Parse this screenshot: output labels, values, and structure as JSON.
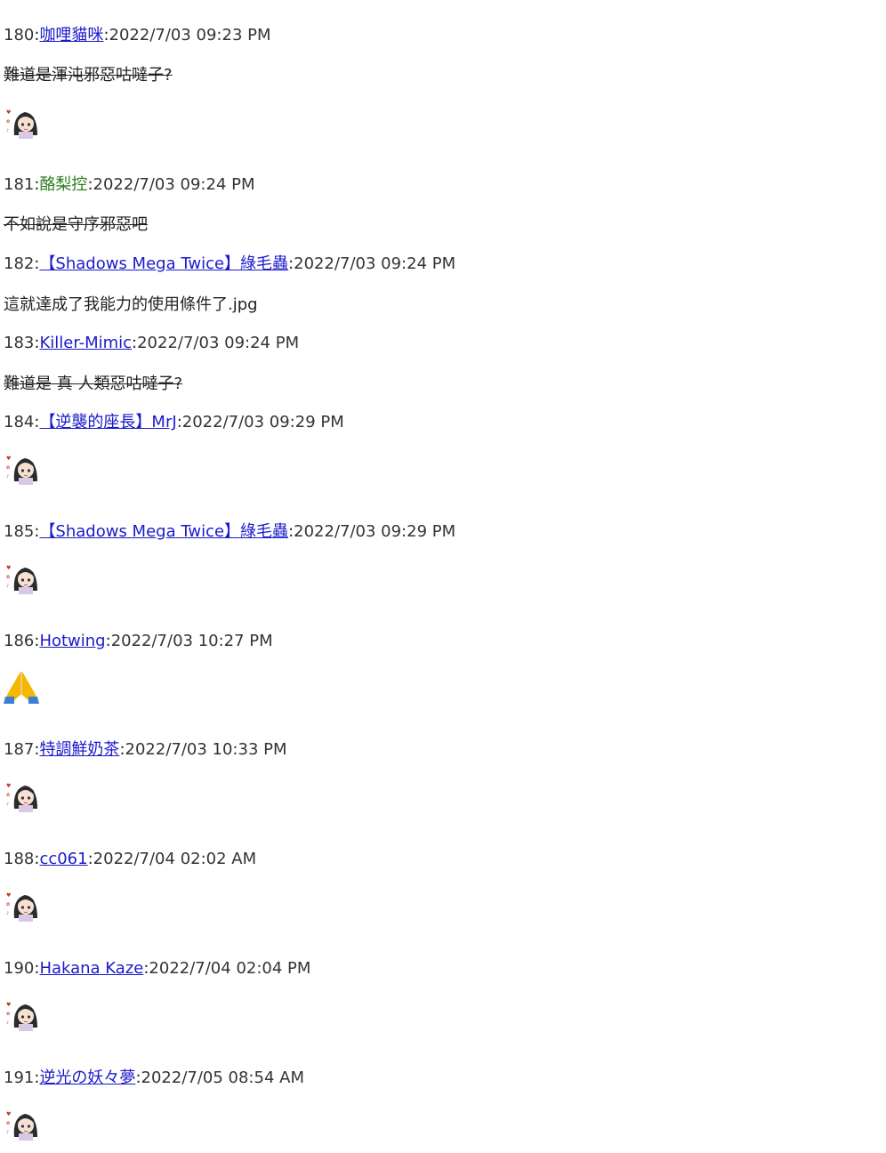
{
  "posts": [
    {
      "num": "180",
      "author": "咖哩貓咪",
      "date": "2022/7/03 09:23 PM",
      "text": "難道是渾沌邪惡咕噠子?",
      "strike": true,
      "sticker": true
    },
    {
      "num": "181",
      "author": "酪梨控",
      "date": "2022/7/03 09:24 PM",
      "text": "不如說是守序邪惡吧",
      "strike": true
    },
    {
      "num": "182",
      "author": "【Shadows Mega Twice】綠毛蟲",
      "date": "2022/7/03 09:24 PM",
      "text": "這就達成了我能力的使用條件了.jpg"
    },
    {
      "num": "183",
      "author": "Killer-Mimic",
      "date": "2022/7/03 09:24 PM",
      "text": "難道是 真 人類惡咕噠子?",
      "strike": true
    },
    {
      "num": "184",
      "author": "【逆襲的座長】MrJ",
      "date": "2022/7/03 09:29 PM",
      "sticker": true
    },
    {
      "num": "185",
      "author": "【Shadows Mega Twice】綠毛蟲",
      "date": "2022/7/03 09:29 PM",
      "sticker": true
    },
    {
      "num": "186",
      "author": "Hotwing",
      "date": "2022/7/03 10:27 PM",
      "emoji": "🙏"
    },
    {
      "num": "187",
      "author": "特調鮮奶茶",
      "date": "2022/7/03 10:33 PM",
      "sticker": true
    },
    {
      "num": "188",
      "author": "cc061",
      "date": "2022/7/04 02:02 AM",
      "sticker": true
    },
    {
      "num": "190",
      "author": "Hakana Kaze",
      "date": "2022/7/04 02:04 PM",
      "sticker": true
    },
    {
      "num": "191",
      "author": "逆光の妖々夢",
      "date": "2022/7/05 08:54 AM",
      "sticker": true
    }
  ],
  "colors": {
    "link": "#1a1acc",
    "plain_author": "#2e7d1e",
    "text": "#222222"
  },
  "icons": {
    "sticker": "anime-girl-sticker-icon",
    "emoji": "praying-hands-icon"
  }
}
